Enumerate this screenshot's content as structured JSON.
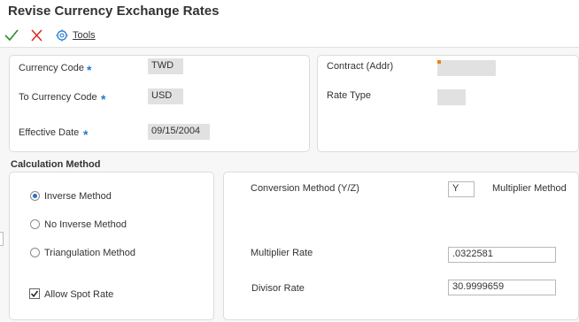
{
  "window": {
    "title": "Revise Currency Exchange Rates"
  },
  "toolbar": {
    "ok_icon": "checkmark-icon",
    "cancel_icon": "x-icon",
    "tools_label": "Tools"
  },
  "header": {
    "currency_code": {
      "label": "Currency Code",
      "value": "TWD",
      "required": "*"
    },
    "to_currency_code": {
      "label": "To Currency Code",
      "value": "USD",
      "required": "*"
    },
    "effective_date": {
      "label": "Effective Date",
      "value": "09/15/2004",
      "required": "*"
    },
    "contract": {
      "label": "Contract (Addr)",
      "value": ""
    },
    "rate_type": {
      "label": "Rate Type",
      "value": ""
    }
  },
  "calculation": {
    "title": "Calculation Method",
    "options": [
      {
        "label": "Inverse Method",
        "selected": true
      },
      {
        "label": "No Inverse Method",
        "selected": false
      },
      {
        "label": "Triangulation Method",
        "selected": false
      }
    ],
    "allow_spot_rate": {
      "label": "Allow Spot Rate",
      "checked": true
    }
  },
  "conversion": {
    "method_label": "Conversion Method (Y/Z)",
    "method_value": "Y",
    "method_desc": "Multiplier Method",
    "multiplier_label": "Multiplier Rate",
    "multiplier_value": ".0322581",
    "divisor_label": "Divisor Rate",
    "divisor_value": "30.9999659"
  },
  "colors": {
    "accent": "#1e7bd1",
    "ok": "#2e8b2e",
    "cancel": "#d9281e",
    "required": "#1e7bd1"
  }
}
